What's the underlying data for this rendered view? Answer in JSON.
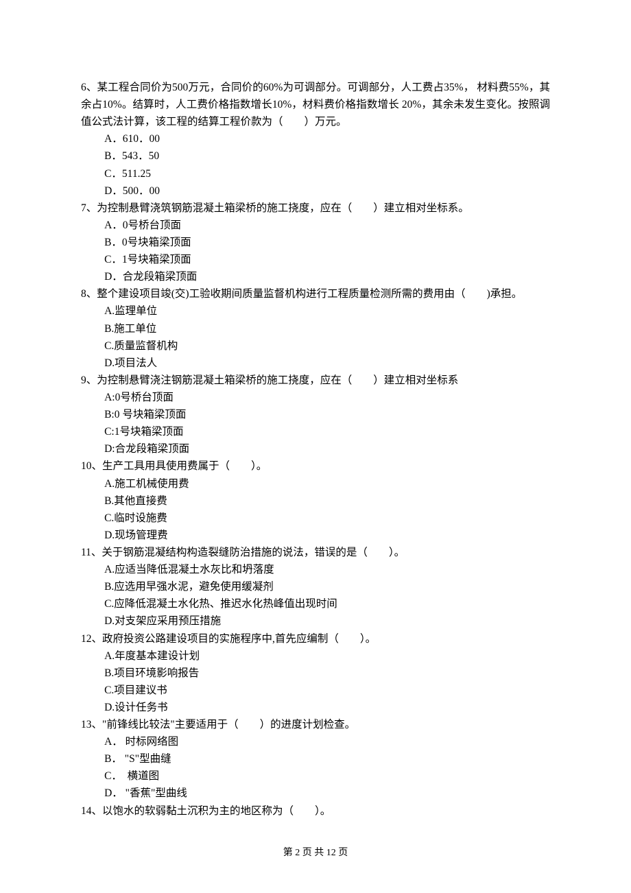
{
  "questions": [
    {
      "stem": "6、某工程合同价为500万元，合同价的60%为可调部分。可调部分，人工费占35%， 材料费55%，其余占10%。结算时，人工费价格指数增长10%，材料费价格指数增长 20%，其余未发生变化。按照调值公式法计算，该工程的结算工程价款为（　　）万元。",
      "options": [
        "A．610．00",
        "B．543．50",
        "C．511.25",
        "D．500．00"
      ]
    },
    {
      "stem": "7、为控制悬臂浇筑钢筋混凝土箱梁桥的施工挠度，应在（　　）建立相对坐标系。",
      "options": [
        "A．0号桥台顶面",
        "B．0号块箱梁顶面",
        "C．1号块箱梁顶面",
        "D．合龙段箱梁顶面"
      ]
    },
    {
      "stem": "8、整个建设项目竣(交)工验收期间质量监督机构进行工程质量检测所需的费用由（　　)承担。",
      "options": [
        "A.监理单位",
        "B.施工单位",
        "C.质量监督机构",
        "D.项目法人"
      ]
    },
    {
      "stem": "9、为控制悬臂浇注钢筋混凝土箱梁桥的施工挠度，应在（　　）建立相对坐标系",
      "options": [
        "A:0号桥台顶面",
        "B:0 号块箱梁顶面",
        "C:1号块箱梁顶面",
        "D:合龙段箱梁顶面"
      ]
    },
    {
      "stem": "10、生产工具用具使用费属于（　　）。",
      "options": [
        "A.施工机械使用费",
        "B.其他直接费",
        "C.临时设施费",
        "D.现场管理费"
      ]
    },
    {
      "stem": "11、关于钢筋混凝结构构造裂缝防治措施的说法，错误的是（　　）。",
      "options": [
        "A.应适当降低混凝土水灰比和坍落度",
        "B.应选用早强水泥，避免使用缓凝剂",
        "C.应降低混凝土水化热、推迟水化热峰值出现时间",
        "D.对支架应采用预压措施"
      ]
    },
    {
      "stem": "12、政府投资公路建设项目的实施程序中,首先应编制（　　）。",
      "options": [
        "A.年度基本建设计划",
        "B.项目环境影响报告",
        "C.项目建议书",
        "D.设计任务书"
      ]
    },
    {
      "stem": "13、\"前锋线比较法\"主要适用于（　　）的进度计划检查。",
      "options": [
        "A． 时标网络图",
        "B． \"S\"型曲缝",
        "C．  横道图",
        "D． \"香蕉\"型曲线"
      ]
    },
    {
      "stem": "14、以饱水的软弱黏土沉积为主的地区称为（　　）。",
      "options": []
    }
  ],
  "footer": "第 2 页 共 12 页"
}
